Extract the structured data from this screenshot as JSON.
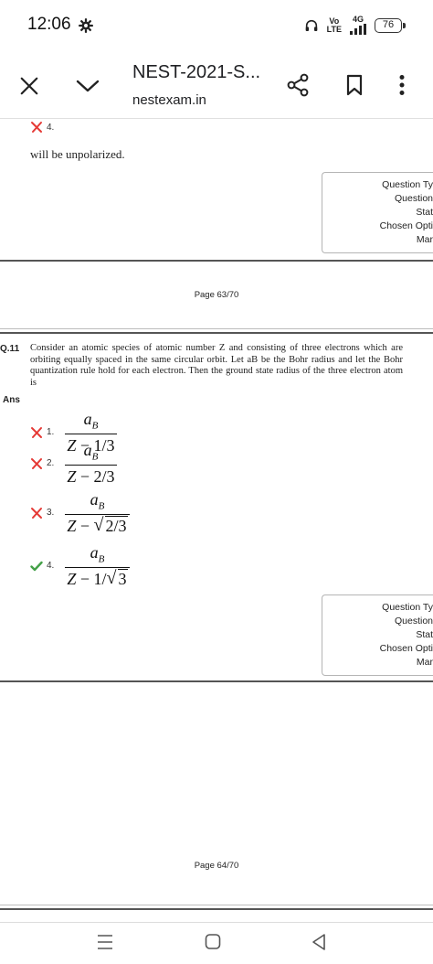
{
  "status_bar": {
    "time": "12:06",
    "volte_top": "Vo",
    "volte_bottom": "LTE",
    "network": "4G",
    "battery": "76"
  },
  "app_bar": {
    "title": "NEST-2021-S...",
    "subtitle": "nestexam.in"
  },
  "prev_question": {
    "option_number": "4.",
    "text_tail": "will be unpolarized.",
    "info_lines": [
      "Question Ty",
      "Question",
      "Stat",
      "Chosen Opti",
      "Mar"
    ]
  },
  "page_63": {
    "label": "Page 63/70"
  },
  "question": {
    "id": "Q.11",
    "text": "Consider an atomic species of atomic number Z and consisting of three electrons which are orbiting equally spaced in the same circular orbit. Let aB be the Bohr radius and let the Bohr quantization rule hold for each electron. Then the ground state radius of the three electron atom is",
    "ans_label": "Ans",
    "options": [
      {
        "number": "1.",
        "status": "wrong",
        "num_base": "a",
        "num_sub": "B",
        "den_prefix": "Z − 1/3",
        "den_root": ""
      },
      {
        "number": "2.",
        "status": "wrong",
        "num_base": "a",
        "num_sub": "B",
        "den_prefix": "Z − 2/3",
        "den_root": ""
      },
      {
        "number": "3.",
        "status": "wrong",
        "num_base": "a",
        "num_sub": "B",
        "den_prefix": "Z − ",
        "den_root": "2/3"
      },
      {
        "number": "4.",
        "status": "correct",
        "num_base": "a",
        "num_sub": "B",
        "den_prefix": "Z − 1/",
        "den_root": "3"
      }
    ],
    "info_lines": [
      "Question Ty",
      "Question",
      "Stat",
      "Chosen Opti",
      "Mar"
    ]
  },
  "page_64": {
    "label": "Page 64/70"
  },
  "colors": {
    "wrong_mark": "#e53935",
    "correct_mark": "#43a047",
    "rule": "#555555"
  },
  "icons": {
    "close": "close-icon",
    "chevron": "chevron-down-icon",
    "share": "share-icon",
    "bookmark": "bookmark-icon",
    "more": "more-vert-icon",
    "settings": "gear-icon",
    "headphones": "headphones-icon",
    "recents": "recents-icon",
    "home": "home-icon",
    "back": "back-icon"
  }
}
